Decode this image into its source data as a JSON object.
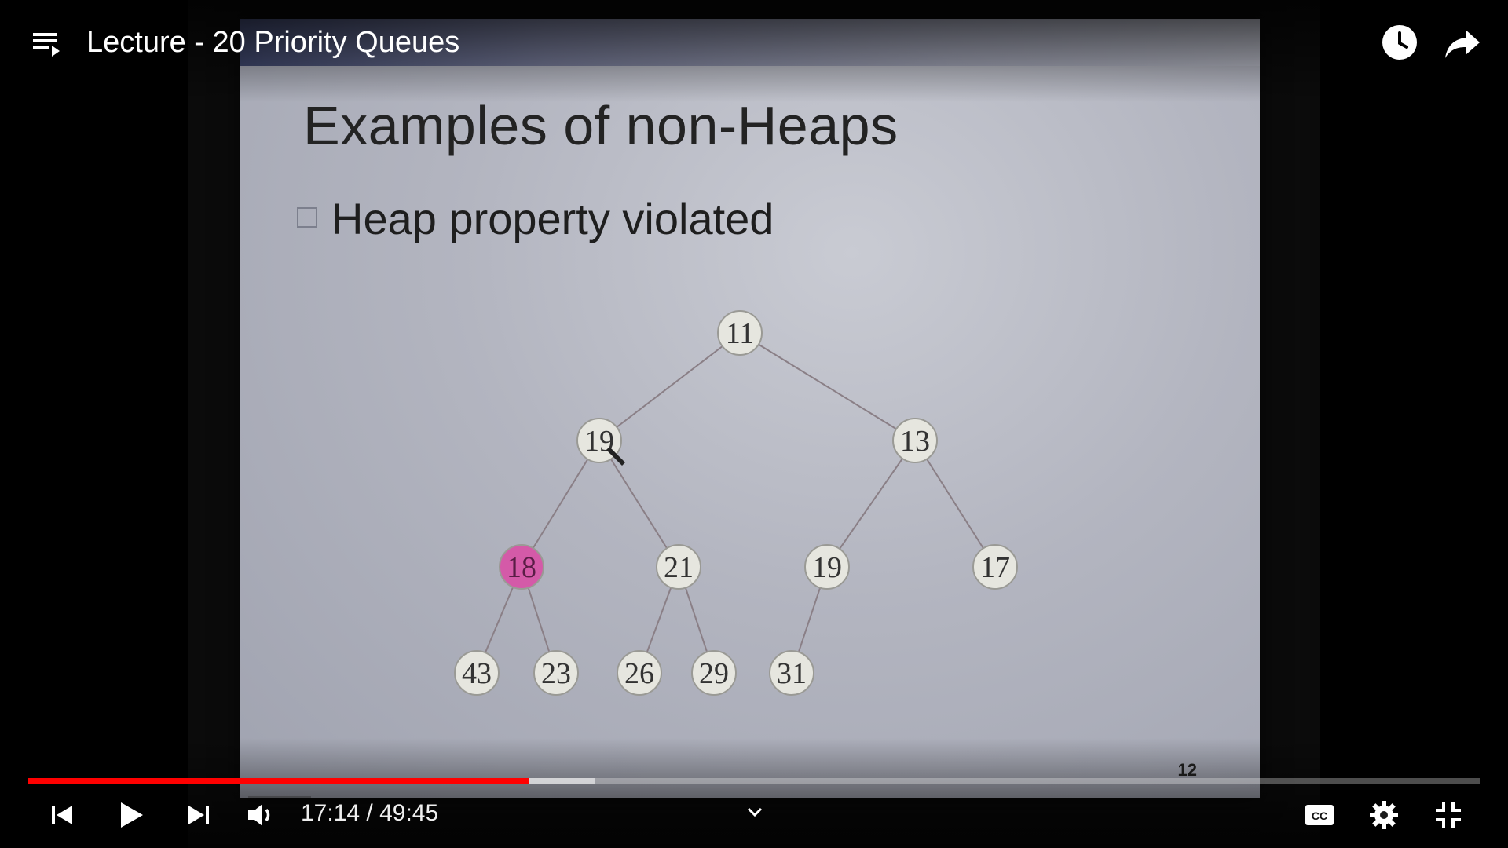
{
  "player": {
    "title": "Lecture - 20 Priority Queues",
    "current_time": "17:14",
    "duration": "49:45",
    "time_display": "17:14 / 49:45",
    "progress_fraction": 0.3455,
    "buffered_fraction": 0.39,
    "accent_color": "#ff0000"
  },
  "icons": {
    "playlist": "playlist-icon",
    "watch_later": "clock-icon",
    "share": "share-icon",
    "previous": "skip-previous-icon",
    "play": "play-icon",
    "next": "skip-next-icon",
    "volume": "volume-icon",
    "chevron": "chevron-down-icon",
    "captions": "closed-captions-icon",
    "settings": "gear-icon",
    "exit_fullscreen": "exit-fullscreen-icon"
  },
  "slide": {
    "title": "Examples of non-Heaps",
    "bullet": "Heap property violated",
    "page_number": "12",
    "tree": {
      "nodes": [
        {
          "id": "n0",
          "label": "11",
          "parent": null,
          "highlight": false
        },
        {
          "id": "n1",
          "label": "19",
          "parent": "n0",
          "highlight": false
        },
        {
          "id": "n2",
          "label": "13",
          "parent": "n0",
          "highlight": false
        },
        {
          "id": "n3",
          "label": "18",
          "parent": "n1",
          "highlight": true
        },
        {
          "id": "n4",
          "label": "21",
          "parent": "n1",
          "highlight": false
        },
        {
          "id": "n5",
          "label": "19",
          "parent": "n2",
          "highlight": false
        },
        {
          "id": "n6",
          "label": "17",
          "parent": "n2",
          "highlight": false
        },
        {
          "id": "n7",
          "label": "43",
          "parent": "n3",
          "highlight": false
        },
        {
          "id": "n8",
          "label": "23",
          "parent": "n3",
          "highlight": false
        },
        {
          "id": "n9",
          "label": "26",
          "parent": "n4",
          "highlight": false
        },
        {
          "id": "n10",
          "label": "29",
          "parent": "n4",
          "highlight": false
        },
        {
          "id": "n11",
          "label": "31",
          "parent": "n5",
          "highlight": false
        }
      ],
      "highlight_color": "#d45aa8"
    }
  }
}
